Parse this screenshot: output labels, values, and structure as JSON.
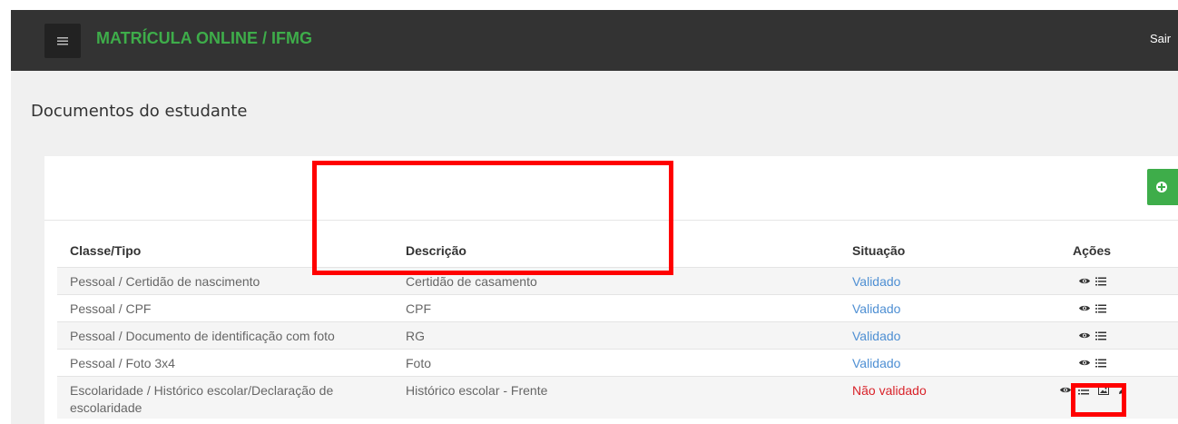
{
  "header": {
    "app_title": "MATRÍCULA ONLINE / IFMG",
    "logout_label": "Sair",
    "menu_icon": "hamburger-menu-icon"
  },
  "page": {
    "title": "Documentos do estudante"
  },
  "panel": {
    "add_icon": "plus-circle-icon"
  },
  "table": {
    "columns": [
      "Classe/Tipo",
      "Descrição",
      "Situação",
      "Ações"
    ],
    "rows": [
      {
        "classe": "Pessoal / Certidão de nascimento",
        "descricao": "Certidão de casamento",
        "situacao": "Validado"
      },
      {
        "classe": "Pessoal / CPF",
        "descricao": "CPF",
        "situacao": "Validado"
      },
      {
        "classe": "Pessoal / Documento de identificação com foto",
        "descricao": "RG",
        "situacao": "Validado"
      },
      {
        "classe": "Pessoal / Foto 3x4",
        "descricao": "Foto",
        "situacao": "Validado"
      },
      {
        "classe": "Escolaridade / Histórico escolar/Declaração de escolaridade",
        "descricao": "Histórico escolar - Frente",
        "situacao": "Não validado"
      }
    ],
    "action_icons": [
      "eye-icon",
      "list-icon",
      "image-icon",
      "pencil-icon"
    ]
  },
  "colors": {
    "topbar": "#333333",
    "brand_green": "#3ead4a",
    "validated_blue": "#4e8fd3",
    "not_validated_red": "#d9232a",
    "highlight_red": "#ff0000"
  }
}
